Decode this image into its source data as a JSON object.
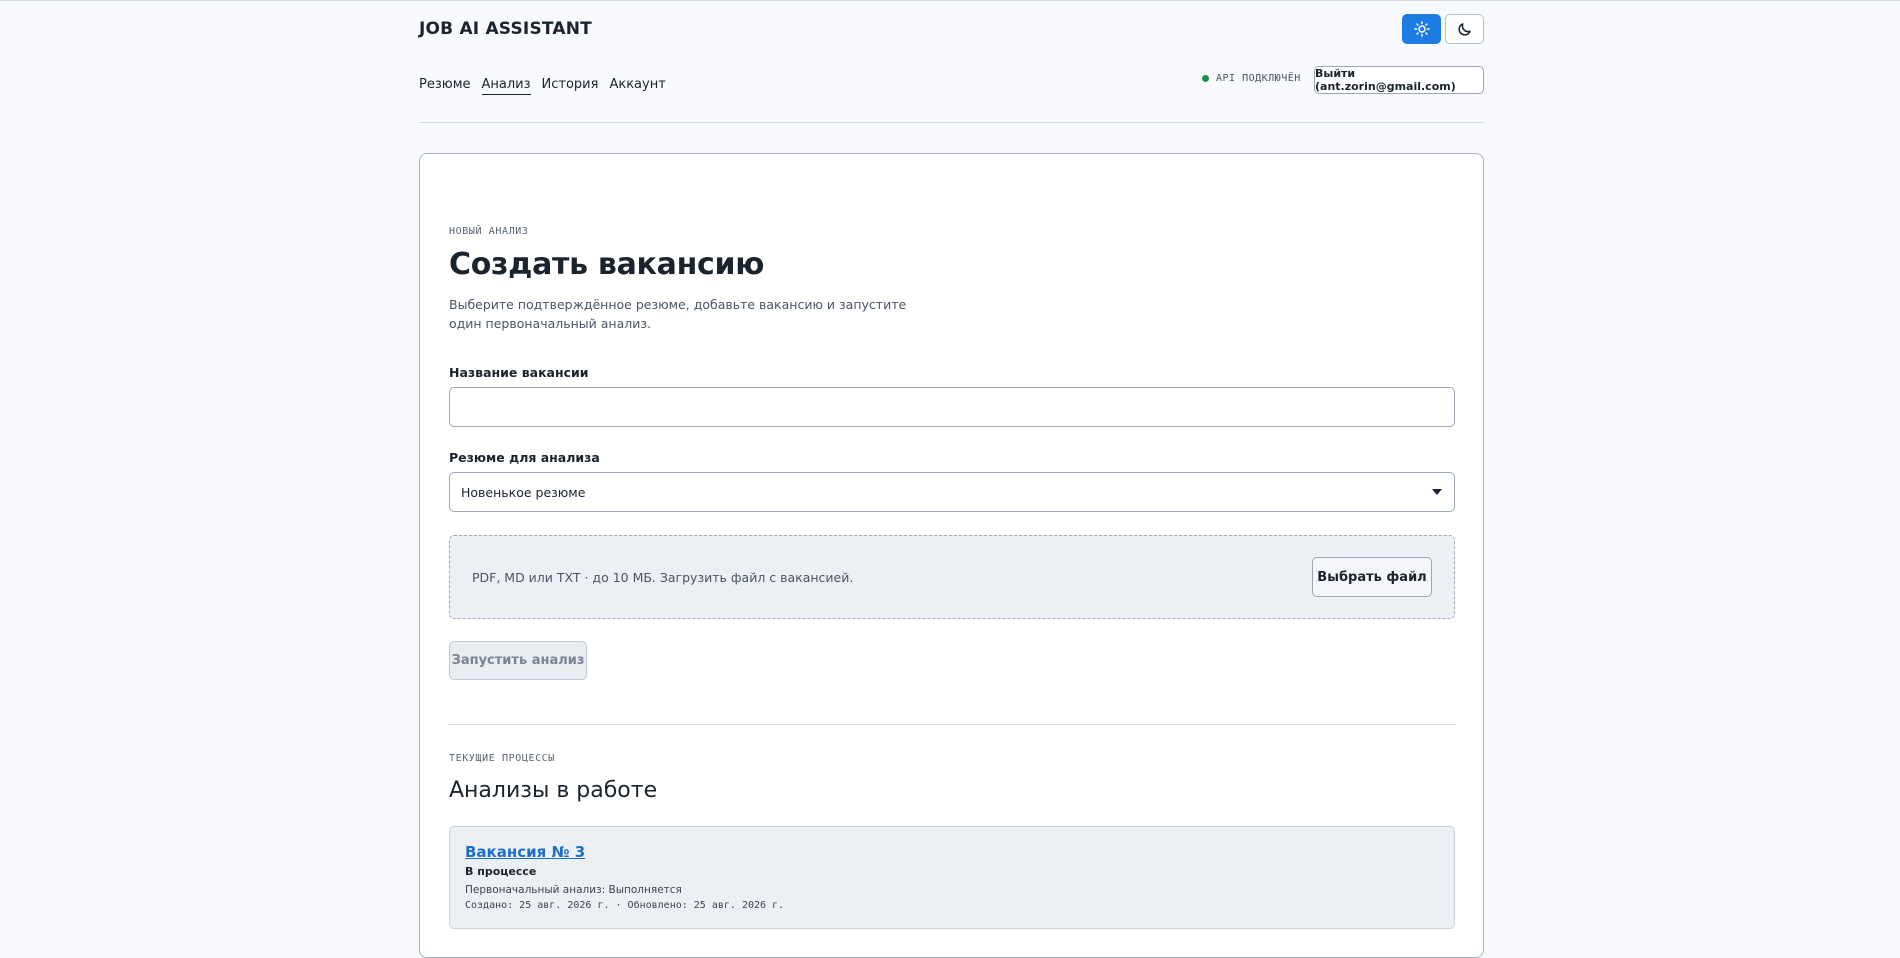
{
  "app": {
    "title": "JOB AI ASSISTANT"
  },
  "theme": {
    "light_icon": "sun-icon",
    "dark_icon": "moon-icon",
    "accent": "#1c7ce4"
  },
  "nav": {
    "items": [
      {
        "label": "Резюме",
        "active": false
      },
      {
        "label": "Анализ",
        "active": true
      },
      {
        "label": "История",
        "active": false
      },
      {
        "label": "Аккаунт",
        "active": false
      }
    ]
  },
  "header": {
    "api_status": "API ПОДКЛЮЧЁН",
    "api_status_color": "#1a8f4e",
    "logout_label": "Выйти (ant.zorin@gmail.com)"
  },
  "form": {
    "eyebrow": "НОВЫЙ АНАЛИЗ",
    "title": "Создать вакансию",
    "subtitle": "Выберите подтверждённое резюме, добавьте вакансию и запустите один первоначальный анализ.",
    "vacancy_label": "Название вакансии",
    "vacancy_value": "",
    "resume_label": "Резюме для анализа",
    "resume_selected": "Новенькое резюме",
    "dropzone_text": "PDF, MD или TXT · до 10 МБ. Загрузить файл с вакансией.",
    "file_button": "Выбрать файл",
    "run_button": "Запустить анализ"
  },
  "processes": {
    "eyebrow": "ТЕКУЩИЕ ПРОЦЕССЫ",
    "title": "Анализы в работе",
    "items": [
      {
        "title": "Вакансия № 3",
        "status": "В процессе",
        "step": "Первоначальный анализ: Выполняется",
        "dates": "Создано: 25 авг. 2026 г. · Обновлено: 25 авг. 2026 г."
      }
    ]
  }
}
